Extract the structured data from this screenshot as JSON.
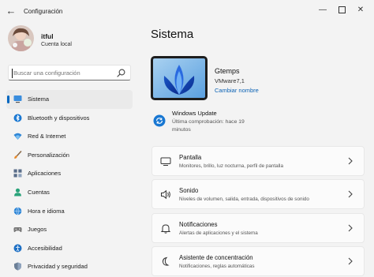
{
  "window": {
    "title": "Configuración",
    "back_icon": "back-arrow-icon",
    "controls": [
      "minimize-icon",
      "maximize-icon",
      "close-icon"
    ]
  },
  "user": {
    "name": "itful",
    "account_type": "Cuenta local"
  },
  "search": {
    "placeholder": "Buscar una configuración",
    "value": "",
    "icon": "search-icon"
  },
  "sidebar": {
    "items": [
      {
        "label": "Sistema",
        "icon": "system-icon",
        "active": true
      },
      {
        "label": "Bluetooth y dispositivos",
        "icon": "bluetooth-icon"
      },
      {
        "label": "Red & Internet",
        "icon": "network-icon"
      },
      {
        "label": "Personalización",
        "icon": "brush-icon"
      },
      {
        "label": "Aplicaciones",
        "icon": "apps-icon"
      },
      {
        "label": "Cuentas",
        "icon": "account-icon"
      },
      {
        "label": "Hora e idioma",
        "icon": "globe-clock-icon"
      },
      {
        "label": "Juegos",
        "icon": "gamepad-icon"
      },
      {
        "label": "Accesibilidad",
        "icon": "accessibility-icon"
      },
      {
        "label": "Privacidad y seguridad",
        "icon": "shield-icon"
      }
    ]
  },
  "main": {
    "title": "Sistema",
    "device": {
      "name": "Gtemps",
      "model": "VMware7,1",
      "rename_label": "Cambiar nombre"
    },
    "windows_update": {
      "title": "Windows Update",
      "status_line1": "Última comprobación: hace 19",
      "status_line2": "minutos",
      "icon": "sync-icon"
    },
    "cards": [
      {
        "title": "Pantalla",
        "subtitle": "Monitores, brillo, luz nocturna, perfil de pantalla",
        "icon": "monitor-icon"
      },
      {
        "title": "Sonido",
        "subtitle": "Niveles de volumen, salida, entrada, dispositivos de sonido",
        "icon": "speaker-icon"
      },
      {
        "title": "Notificaciones",
        "subtitle": "Alertas de aplicaciones y el sistema",
        "icon": "bell-icon"
      },
      {
        "title": "Asistente de concentración",
        "subtitle": "Notificaciones, reglas automáticas",
        "icon": "moon-icon"
      }
    ]
  },
  "colors": {
    "accent": "#0067c0",
    "background": "#f3f3f3",
    "card": "#fbfbfb"
  }
}
